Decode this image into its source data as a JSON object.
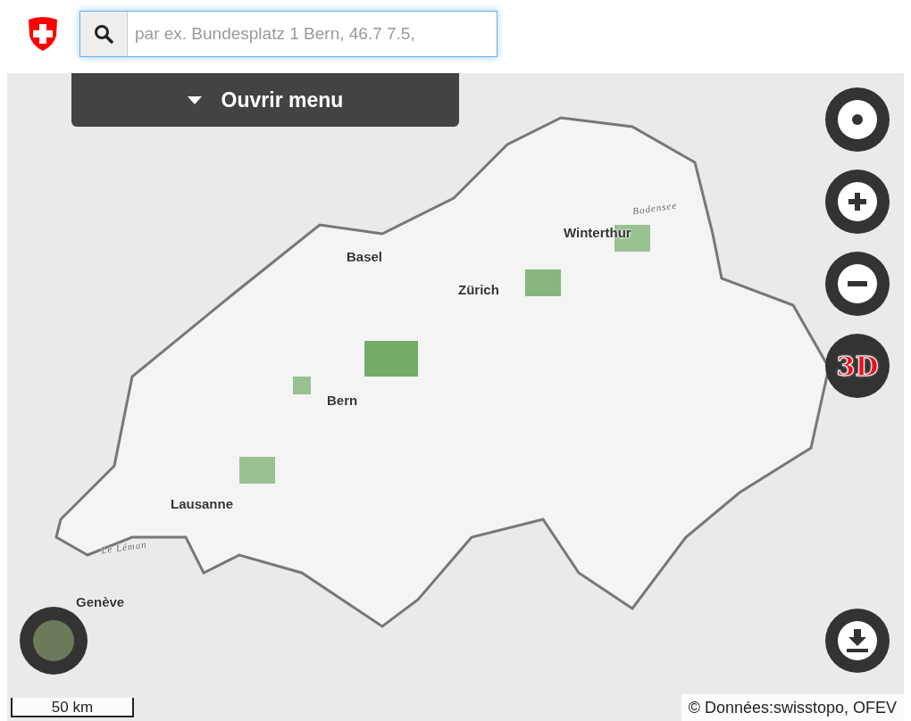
{
  "search": {
    "placeholder": "par ex. Bundesplatz 1 Bern, 46.7 7.5,"
  },
  "menu_button": {
    "label": "Ouvrir menu"
  },
  "map_labels": [
    {
      "text": "Winterthur",
      "kind": "city"
    },
    {
      "text": "Basel",
      "kind": "city"
    },
    {
      "text": "Zürich",
      "kind": "city"
    },
    {
      "text": "Bern",
      "kind": "city"
    },
    {
      "text": "Lausanne",
      "kind": "city"
    },
    {
      "text": "Genève",
      "kind": "city"
    },
    {
      "text": "Le Léman",
      "kind": "lake"
    },
    {
      "text": "Bodensee",
      "kind": "lake"
    }
  ],
  "map_controls": [
    {
      "kind": "locate"
    },
    {
      "kind": "zoom-in"
    },
    {
      "kind": "zoom-out"
    },
    {
      "kind": "perspective",
      "label": "3D"
    }
  ],
  "scale_bar": {
    "label": "50 km"
  },
  "attribution": "© Données:swisstopo, OFEV"
}
